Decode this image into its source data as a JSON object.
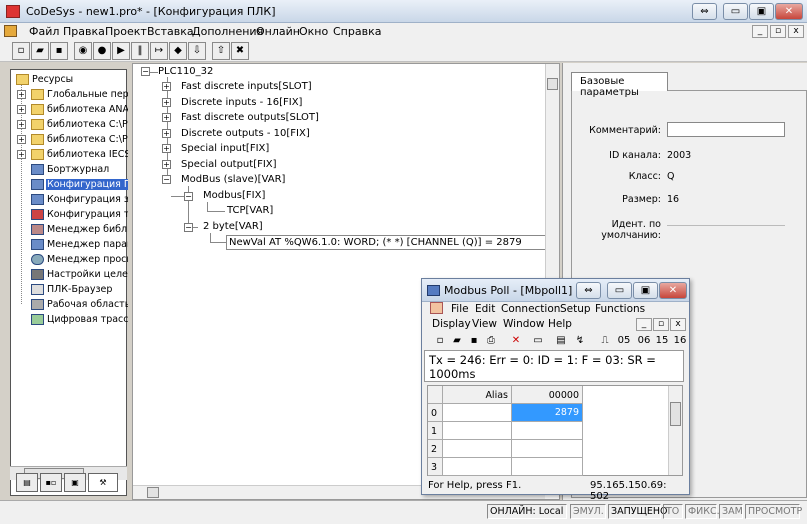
{
  "window": {
    "title": "CoDeSys - new1.pro* - [Конфигурация ПЛК]",
    "btn_restore": "⇔",
    "btn_minimize": "▭",
    "btn_maximize": "▣",
    "btn_close": "✕"
  },
  "menu": {
    "items": [
      "Файл",
      "Правка",
      "Проект",
      "Вставка",
      "Дополнения",
      "Онлайн",
      "Окно",
      "Справка"
    ]
  },
  "mdi": {
    "minimize": "_",
    "restore": "▫",
    "close": "x"
  },
  "left_tree": {
    "items": [
      {
        "label": "Ресурсы",
        "level": 0,
        "exp": "",
        "icon": "folder"
      },
      {
        "label": "Глобальные перем",
        "level": 1,
        "exp": "+",
        "icon": "folder"
      },
      {
        "label": "библиотека ANAL\\",
        "level": 1,
        "exp": "+",
        "icon": "folder"
      },
      {
        "label": "библиотека C:\\Pro",
        "level": 1,
        "exp": "+",
        "icon": "folder"
      },
      {
        "label": "библиотека C:\\Pro",
        "level": 1,
        "exp": "+",
        "icon": "folder"
      },
      {
        "label": "библиотека IECSFI",
        "level": 1,
        "exp": "+",
        "icon": "folder"
      },
      {
        "label": "Бортжурнал",
        "level": 1,
        "exp": "",
        "icon": "node"
      },
      {
        "label": "Конфигурация ПЛ",
        "level": 1,
        "exp": "",
        "icon": "node",
        "selected": true
      },
      {
        "label": "Конфигурация зад",
        "level": 1,
        "exp": "",
        "icon": "node"
      },
      {
        "label": "Конфигурация тре",
        "level": 1,
        "exp": "",
        "icon": "node"
      },
      {
        "label": "Менеджер библио",
        "level": 1,
        "exp": "",
        "icon": "node"
      },
      {
        "label": "Менеджер параме",
        "level": 1,
        "exp": "",
        "icon": "node"
      },
      {
        "label": "Менеджер просмо",
        "level": 1,
        "exp": "",
        "icon": "node"
      },
      {
        "label": "Настройки целево",
        "level": 1,
        "exp": "",
        "icon": "node"
      },
      {
        "label": "ПЛК-Браузер",
        "level": 1,
        "exp": "",
        "icon": "node"
      },
      {
        "label": "Рабочая область",
        "level": 1,
        "exp": "",
        "icon": "node"
      },
      {
        "label": "Цифровая трассир",
        "level": 1,
        "exp": "",
        "icon": "node"
      }
    ]
  },
  "center_tree": {
    "root": "PLC110_32",
    "items": [
      "Fast discrete inputs[SLOT]",
      "Discrete inputs - 16[FIX]",
      "Fast discrete outputs[SLOT]",
      "Discrete outputs - 10[FIX]",
      "Special input[FIX]",
      "Special output[FIX]",
      "ModBus (slave)[VAR]"
    ],
    "modbus_fix": "Modbus[FIX]",
    "tcp": "TCP[VAR]",
    "two_byte": "2 byte[VAR]",
    "variable": "NewVal AT %QW6.1.0: WORD; (*  *) [CHANNEL (Q)] = 2879"
  },
  "right_panel": {
    "tab": "Базовые параметры",
    "comment_label": "Комментарий:",
    "id_label": "ID канала:",
    "id_value": "2003",
    "class_label": "Класс:",
    "class_value": "Q",
    "size_label": "Размер:",
    "size_value": "16",
    "default_label_1": "Идент. по",
    "default_label_2": "умолчанию:"
  },
  "status_bar": {
    "online": "ОНЛАЙН: Local",
    "emul": "ЭМУЛ.",
    "running": "ЗАПУЩЕНО",
    "to": "ТО",
    "fix": "ФИКС.",
    "zam": "ЗАМ",
    "view": "ПРОСМОТР"
  },
  "modbus_poll": {
    "title": "Modbus Poll - [Mbpoll1]",
    "menu_row1": [
      "File",
      "Edit",
      "Connection",
      "Setup",
      "Functions"
    ],
    "menu_row2": [
      "Display",
      "View",
      "Window",
      "Help"
    ],
    "toolbar_codes": [
      "05",
      "06",
      "15",
      "16"
    ],
    "info": "Tx = 246: Err = 0: ID = 1: F = 03: SR = 1000ms",
    "grid": {
      "col_alias": "Alias",
      "col_value": "00000",
      "rows": [
        {
          "index": "0",
          "alias": "",
          "value": "2879"
        },
        {
          "index": "1",
          "alias": "",
          "value": ""
        },
        {
          "index": "2",
          "alias": "",
          "value": ""
        },
        {
          "index": "3",
          "alias": "",
          "value": ""
        }
      ]
    },
    "status_left": "For Help, press F1.",
    "status_right": "95.165.150.69: 502"
  }
}
